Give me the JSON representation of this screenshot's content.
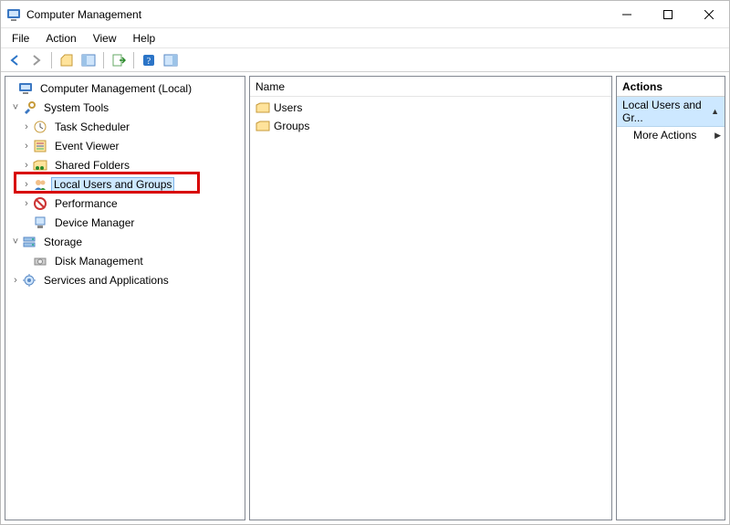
{
  "window": {
    "title": "Computer Management"
  },
  "menubar": {
    "file": "File",
    "action": "Action",
    "view": "View",
    "help": "Help"
  },
  "tree": {
    "root": "Computer Management (Local)",
    "system_tools": "System Tools",
    "task_scheduler": "Task Scheduler",
    "event_viewer": "Event Viewer",
    "shared_folders": "Shared Folders",
    "local_users_groups": "Local Users and Groups",
    "performance": "Performance",
    "device_manager": "Device Manager",
    "storage": "Storage",
    "disk_management": "Disk Management",
    "services_apps": "Services and Applications"
  },
  "list": {
    "column_name": "Name",
    "items": [
      {
        "label": "Users"
      },
      {
        "label": "Groups"
      }
    ]
  },
  "actions": {
    "header": "Actions",
    "section_title": "Local Users and Gr...",
    "more_actions": "More Actions"
  }
}
